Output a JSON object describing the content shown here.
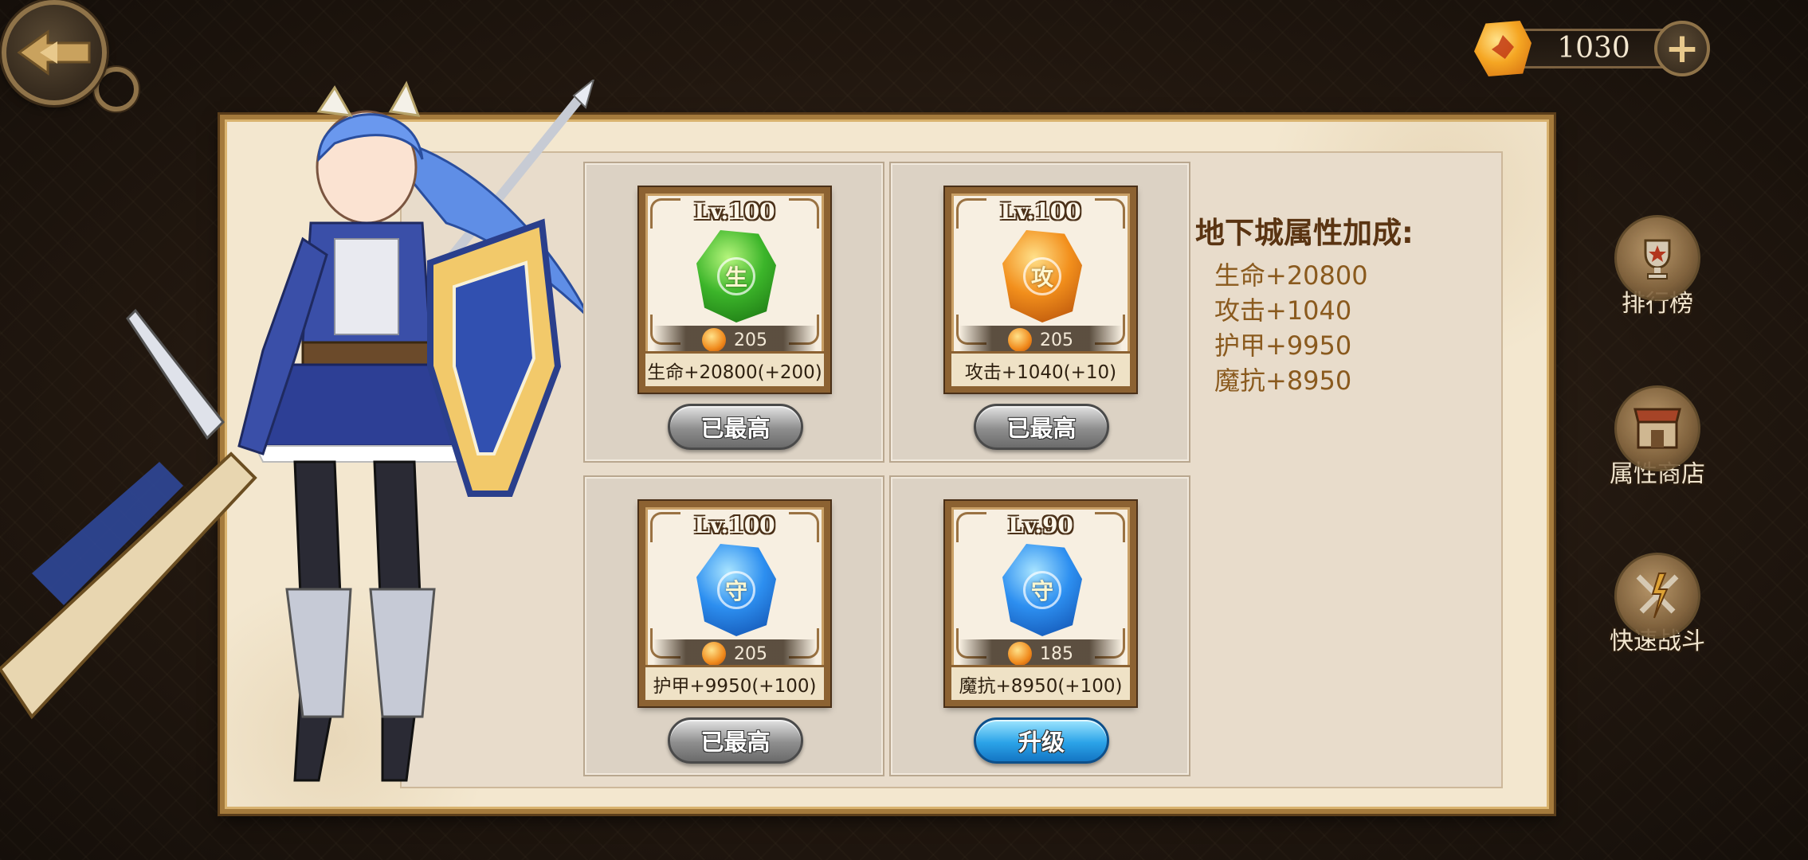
{
  "currency": {
    "value": "1030",
    "plus_label": "+"
  },
  "cards": [
    {
      "level": "Lv.100",
      "gem_char": "生",
      "gem_color": "green",
      "cost": "205",
      "stat": "生命+20800(+200)",
      "button": "已最高",
      "button_state": "max"
    },
    {
      "level": "Lv.100",
      "gem_char": "攻",
      "gem_color": "orange",
      "cost": "205",
      "stat": "攻击+1040(+10)",
      "button": "已最高",
      "button_state": "max"
    },
    {
      "level": "Lv.100",
      "gem_char": "守",
      "gem_color": "blue",
      "cost": "205",
      "stat": "护甲+9950(+100)",
      "button": "已最高",
      "button_state": "max"
    },
    {
      "level": "Lv.90",
      "gem_char": "守",
      "gem_color": "blue",
      "cost": "185",
      "stat": "魔抗+8950(+100)",
      "button": "升级",
      "button_state": "upgrade"
    }
  ],
  "bonus": {
    "title": "地下城属性加成:",
    "items": [
      "生命+20800",
      "攻击+1040",
      "护甲+9950",
      "魔抗+8950"
    ]
  },
  "side_buttons": [
    {
      "label": "排行榜",
      "icon": "trophy-icon"
    },
    {
      "label": "属性商店",
      "icon": "shop-icon"
    },
    {
      "label": "快速战斗",
      "icon": "swords-icon"
    }
  ]
}
